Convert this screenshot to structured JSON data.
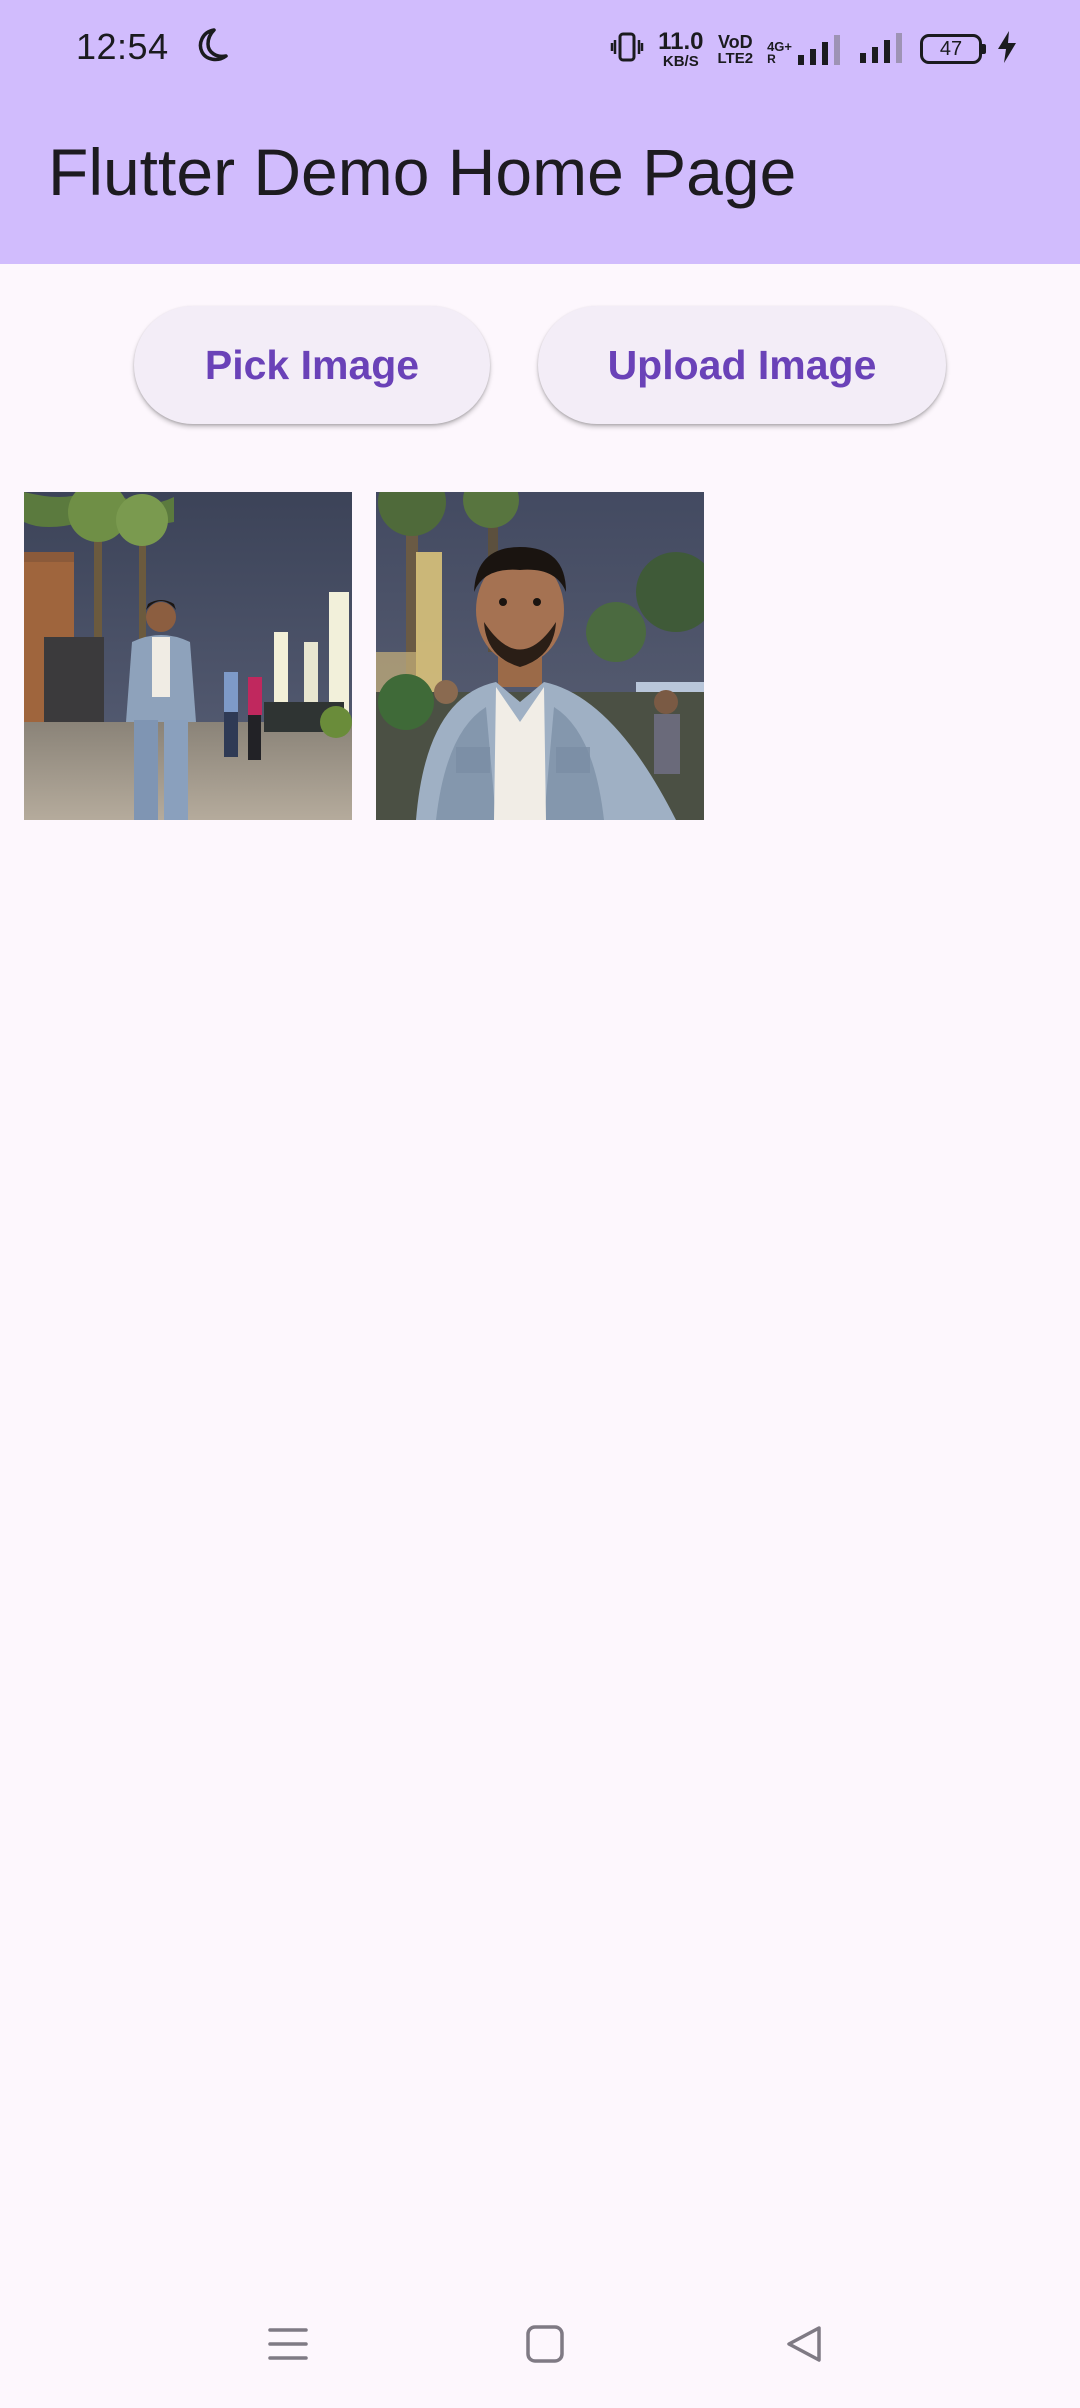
{
  "status_bar": {
    "time": "12:54",
    "net_speed_value": "11.0",
    "net_speed_unit": "KB/S",
    "volte_top": "VoD",
    "volte_bottom": "LTE2",
    "network_type": "4G+",
    "battery_level": "47",
    "icons": [
      "moon-icon",
      "vibrate-icon",
      "signal-icon",
      "battery-icon",
      "charging-icon"
    ]
  },
  "app_bar": {
    "title": "Flutter Demo Home Page"
  },
  "actions": {
    "pick_label": "Pick Image",
    "upload_label": "Upload Image"
  },
  "images": [
    {
      "name": "selected-photo-1"
    },
    {
      "name": "selected-photo-2"
    }
  ],
  "nav_bar": {
    "icons": [
      "menu-icon",
      "home-icon",
      "back-icon"
    ]
  },
  "colors": {
    "app_bar": "#d1bcfd",
    "background": "#fdf7fd",
    "button_bg": "#f3edf7",
    "button_text": "#6a42b8"
  }
}
